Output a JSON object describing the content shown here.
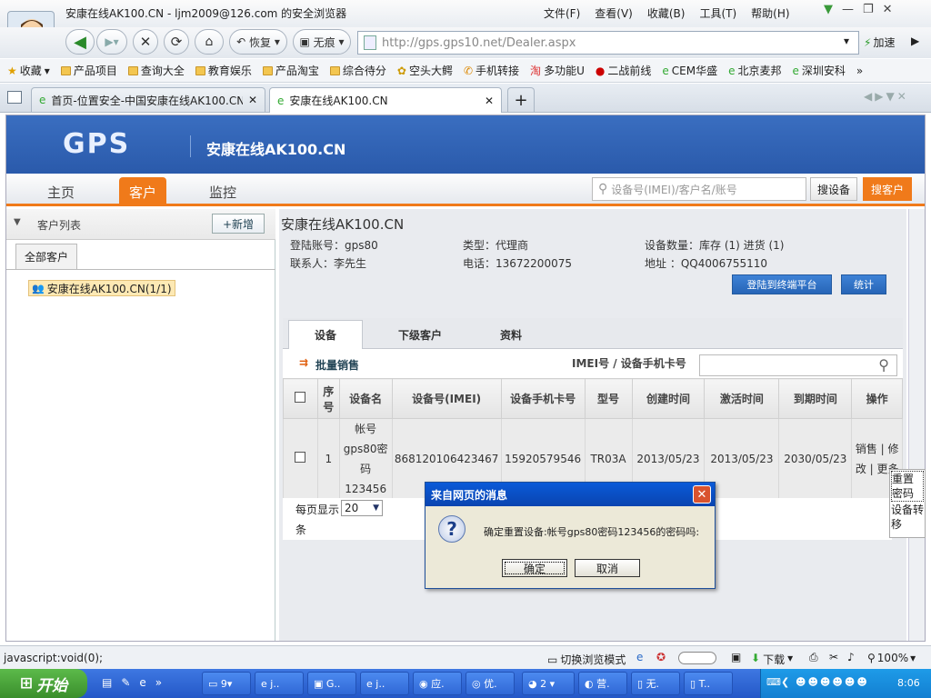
{
  "window": {
    "title": "安康在线AK100.CN - ljm2009@126.com 的安全浏览器",
    "menu": [
      "文件(F)",
      "查看(V)",
      "收藏(B)",
      "工具(T)",
      "帮助(H)"
    ]
  },
  "navbar": {
    "restore": "恢复",
    "no_trace": "无痕",
    "url": "http://gps.gps10.net/Dealer.aspx",
    "speedup": "加速"
  },
  "bookmarks": [
    "收藏",
    "产品项目",
    "查询大全",
    "教育娱乐",
    "产品淘宝",
    "综合待分",
    "空头大鳄",
    "手机转接",
    "多功能U",
    "二战前线",
    "CEM华盛",
    "北京麦邦",
    "深圳安科"
  ],
  "tabs": [
    {
      "label": "首页-位置安全-中国安康在线AK100.CN"
    },
    {
      "label": "安康在线AK100.CN"
    }
  ],
  "site": {
    "logo": "GPS",
    "name": "安康在线AK100.CN",
    "nav": [
      "主页",
      "客户",
      "监控"
    ],
    "search_placeholder": "设备号(IMEI)/客户名/账号",
    "search_device": "搜设备",
    "search_customer": "搜客户"
  },
  "left": {
    "heading": "客户列表",
    "new_button": "+新增",
    "all_tab": "全部客户",
    "tree_item": "安康在线AK100.CN(1/1)"
  },
  "detail": {
    "title": "安康在线AK100.CN",
    "login_account": "登陆账号：gps80",
    "type": "类型：代理商",
    "device_count": "设备数量：库存 (1) 进货 (1)",
    "contact": "联系人：李先生",
    "phone": "电话：13672200075",
    "address": "地址 ：QQ4006755110",
    "login_btn": "登陆到终端平台",
    "stats_btn": "统计",
    "tabs": [
      "设备",
      "下级客户",
      "资料"
    ],
    "batch_sell": "批量销售",
    "imei_label": "IMEI号 / 设备手机卡号",
    "columns": [
      "序号",
      "设备名",
      "设备号(IMEI)",
      "设备手机卡号",
      "型号",
      "创建时间",
      "激活时间",
      "到期时间",
      "操作"
    ],
    "rows": [
      {
        "no": "1",
        "name": "帐号gps80密码123456",
        "imei": "868120106423467",
        "sim": "15920579546",
        "model": "TR03A",
        "created": "2013/05/23",
        "activated": "2013/05/23",
        "expires": "2030/05/23",
        "ops": "销售 | 修改 | 更多"
      }
    ],
    "per_page_label": "每页显示",
    "per_page_value": "20",
    "per_page_unit": "条"
  },
  "popup_menu": [
    "重置密码",
    "设备转移"
  ],
  "dialog": {
    "title": "来自网页的消息",
    "message": "确定重置设备:帐号gps80密码123456的密码吗:",
    "ok": "确定",
    "cancel": "取消"
  },
  "statusbar": {
    "left": "javascript:void(0);",
    "switch_mode": "切换浏览模式",
    "download": "下载",
    "zoom": "100%"
  },
  "taskbar": {
    "start": "开始",
    "items": [
      "9",
      "j..",
      "G..",
      "j..",
      "应.",
      "优.",
      "2",
      "营.",
      "无.",
      "T.."
    ],
    "clock": "8:06"
  }
}
